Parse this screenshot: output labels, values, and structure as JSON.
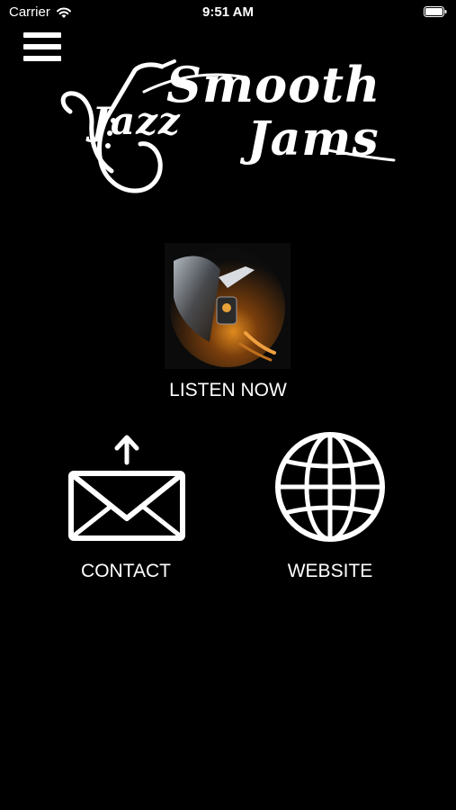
{
  "status_bar": {
    "carrier": "Carrier",
    "time": "9:51 AM"
  },
  "header": {
    "menu_icon": "hamburger-menu-icon"
  },
  "logo": {
    "line1": "Smooth",
    "line2": "Jazz",
    "line3": "Jams"
  },
  "main": {
    "listen_label": "LISTEN NOW",
    "listen_art": "turntable-image",
    "contact_label": "CONTACT",
    "contact_icon": "envelope-upload-icon",
    "website_label": "WEBSITE",
    "website_icon": "globe-icon"
  },
  "colors": {
    "background": "#000000",
    "foreground": "#ffffff"
  }
}
